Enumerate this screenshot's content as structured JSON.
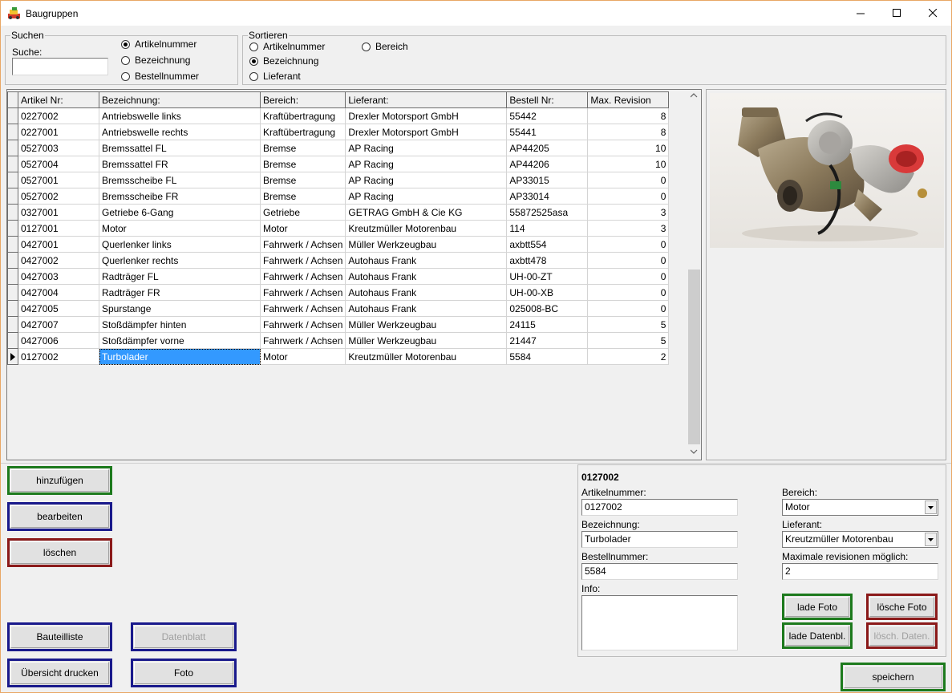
{
  "window": {
    "title": "Baugruppen"
  },
  "search": {
    "group_label": "Suchen",
    "field_label": "Suche:",
    "value": "",
    "options": [
      "Artikelnummer",
      "Bezeichnung",
      "Bestellnummer"
    ],
    "selected_index": 0
  },
  "sort": {
    "group_label": "Sortieren",
    "options": [
      "Artikelnummer",
      "Bezeichnung",
      "Lieferant",
      "Bereich"
    ],
    "selected_index": 1
  },
  "table": {
    "columns": [
      "Artikel Nr:",
      "Bezeichnung:",
      "Bereich:",
      "Lieferant:",
      "Bestell Nr:",
      "Max. Revision"
    ],
    "rows": [
      [
        "0227002",
        "Antriebswelle links",
        "Kraftübertragung",
        "Drexler Motorsport GmbH",
        "55442",
        "8"
      ],
      [
        "0227001",
        "Antriebswelle rechts",
        "Kraftübertragung",
        "Drexler Motorsport GmbH",
        "55441",
        "8"
      ],
      [
        "0527003",
        "Bremssattel FL",
        "Bremse",
        "AP Racing",
        "AP44205",
        "10"
      ],
      [
        "0527004",
        "Bremssattel FR",
        "Bremse",
        "AP Racing",
        "AP44206",
        "10"
      ],
      [
        "0527001",
        "Bremsscheibe FL",
        "Bremse",
        "AP Racing",
        "AP33015",
        "0"
      ],
      [
        "0527002",
        "Bremsscheibe FR",
        "Bremse",
        "AP Racing",
        "AP33014",
        "0"
      ],
      [
        "0327001",
        "Getriebe 6-Gang",
        "Getriebe",
        "GETRAG GmbH & Cie KG",
        "55872525asa",
        "3"
      ],
      [
        "0127001",
        "Motor",
        "Motor",
        "Kreutzmüller Motorenbau",
        "114",
        "3"
      ],
      [
        "0427001",
        "Querlenker links",
        "Fahrwerk / Achsen",
        "Müller Werkzeugbau",
        "axbtt554",
        "0"
      ],
      [
        "0427002",
        "Querlenker rechts",
        "Fahrwerk / Achsen",
        "Autohaus Frank",
        "axbtt478",
        "0"
      ],
      [
        "0427003",
        "Radträger FL",
        "Fahrwerk / Achsen",
        "Autohaus Frank",
        "UH-00-ZT",
        "0"
      ],
      [
        "0427004",
        "Radträger FR",
        "Fahrwerk / Achsen",
        "Autohaus Frank",
        "UH-00-XB",
        "0"
      ],
      [
        "0427005",
        "Spurstange",
        "Fahrwerk / Achsen",
        "Autohaus Frank",
        "025008-BC",
        "0"
      ],
      [
        "0427007",
        "Stoßdämpfer hinten",
        "Fahrwerk / Achsen",
        "Müller Werkzeugbau",
        "24115",
        "5"
      ],
      [
        "0427006",
        "Stoßdämpfer vorne",
        "Fahrwerk / Achsen",
        "Müller Werkzeugbau",
        "21447",
        "5"
      ],
      [
        "0127002",
        "Turbolader",
        "Motor",
        "Kreutzmüller Motorenbau",
        "5584",
        "2"
      ]
    ],
    "selected_row": 15
  },
  "buttons": {
    "add": "hinzufügen",
    "edit": "bearbeiten",
    "delete": "löschen",
    "parts_list": "Bauteilliste",
    "datasheet": "Datenblatt",
    "print_overview": "Übersicht drucken",
    "photo": "Foto",
    "load_photo": "lade Foto",
    "delete_photo": "lösche Foto",
    "load_datasheet": "lade Datenbl.",
    "delete_datasheet": "lösch. Daten.",
    "save": "speichern"
  },
  "detail": {
    "header": "0127002",
    "article_label": "Artikelnummer:",
    "article_value": "0127002",
    "name_label": "Bezeichnung:",
    "name_value": "Turbolader",
    "order_label": "Bestellnummer:",
    "order_value": "5584",
    "info_label": "Info:",
    "info_value": "",
    "area_label": "Bereich:",
    "area_value": "Motor",
    "supplier_label": "Lieferant:",
    "supplier_value": "Kreutzmüller Motorenbau",
    "maxrev_label": "Maximale revisionen möglich:",
    "maxrev_value": "2"
  }
}
